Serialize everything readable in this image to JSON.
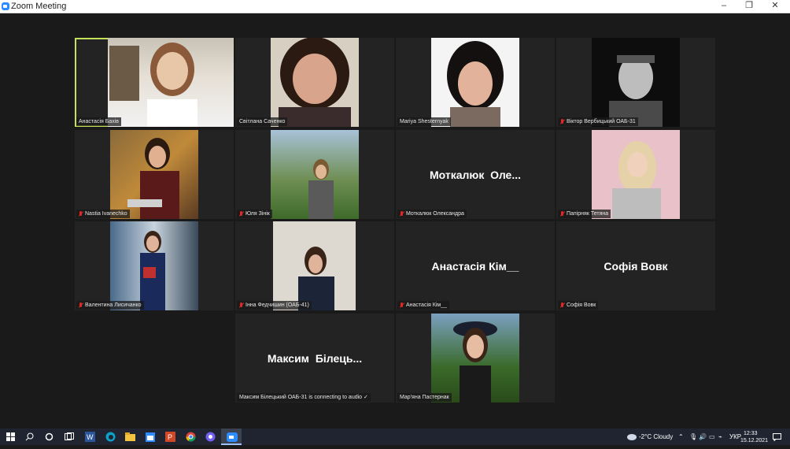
{
  "window": {
    "title": "Zoom Meeting",
    "minimize": "–",
    "restore": "❐",
    "close": "✕"
  },
  "participants": [
    {
      "name": "Анастасія Бахів",
      "muted": false
    },
    {
      "name": "Світлана Саченко",
      "muted": false
    },
    {
      "name": "Mariya Shesternyak",
      "muted": false
    },
    {
      "name": "Віктор Вербицький ОАБ-31",
      "muted": true
    },
    {
      "name": "Nastia Ivanechko",
      "muted": true
    },
    {
      "name": "Юля Зінік",
      "muted": true
    },
    {
      "name": "Моткалюк Олександра",
      "muted": true,
      "display_name": "Моткалюк  Оле..."
    },
    {
      "name": "Папірняк Тетяна",
      "muted": true
    },
    {
      "name": "Валентина Лисичанко",
      "muted": true
    },
    {
      "name": "Інна Федчишин  (ОАБ-41)",
      "muted": true
    },
    {
      "name": "Анастасія Кім__",
      "muted": true,
      "display_name": "Анастасія Кім__"
    },
    {
      "name": "Софія Вовк",
      "muted": true,
      "display_name": "Софія Вовк"
    },
    {
      "name": "Максим Білецький ОАБ-31 is connecting to audio ✓",
      "muted": false,
      "display_name": "Максим  Білець..."
    },
    {
      "name": "Мар'яна Пастернак",
      "muted": false
    }
  ],
  "taskbar": {
    "start_icon": "windows-start-icon",
    "weather": "-2°C  Cloudy",
    "language": "УКР",
    "time": "12:33",
    "date": "15.12.2021"
  }
}
